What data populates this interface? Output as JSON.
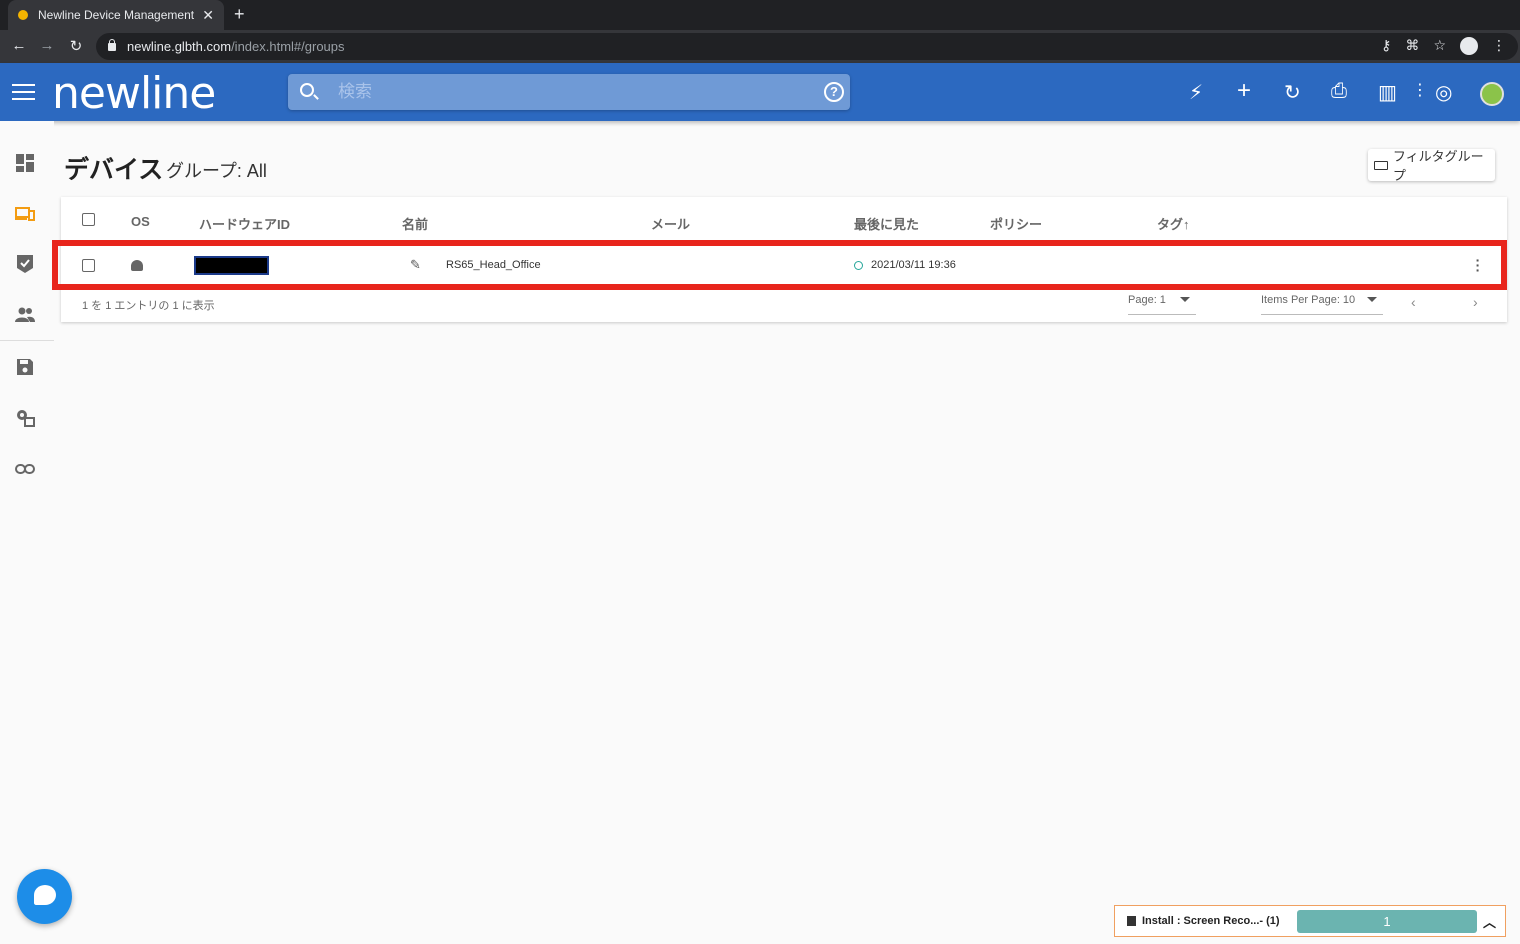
{
  "browser": {
    "tab_title": "Newline Device Management",
    "tab_close": "✕",
    "new_tab": "+",
    "url_host": "newline.glbth.com",
    "url_path": "/index.html#/groups"
  },
  "appbar": {
    "logo": "newline",
    "search_placeholder": "検索",
    "help": "?"
  },
  "page": {
    "title": "デバイス",
    "subtitle": "グループ: All",
    "filter_button": "フィルタグループ"
  },
  "table": {
    "columns": {
      "os": "OS",
      "hardware_id": "ハードウェアID",
      "name": "名前",
      "email": "メール",
      "last_seen": "最後に見た",
      "policy": "ポリシー",
      "tags": "タグ↑"
    },
    "rows": [
      {
        "os_icon": "android-icon",
        "hardware_id": "",
        "name": "RS65_Head_Office",
        "email": "",
        "last_seen": "2021/03/11 19:36",
        "policy": "",
        "tags": ""
      }
    ],
    "footer": {
      "summary": "1 を 1 エントリの 1 に表示",
      "page_label": "Page: 1",
      "items_per_page": "Items Per Page: 10",
      "prev": "‹",
      "next": "›"
    }
  },
  "install_toast": {
    "text": "Install : Screen Reco...- (1)",
    "progress_label": "1",
    "chevron": "︿"
  },
  "colors": {
    "appbar": "#2c69c0",
    "highlight": "#e8251c",
    "accent_orange": "#f39c12",
    "progress": "#6bb4b0"
  }
}
